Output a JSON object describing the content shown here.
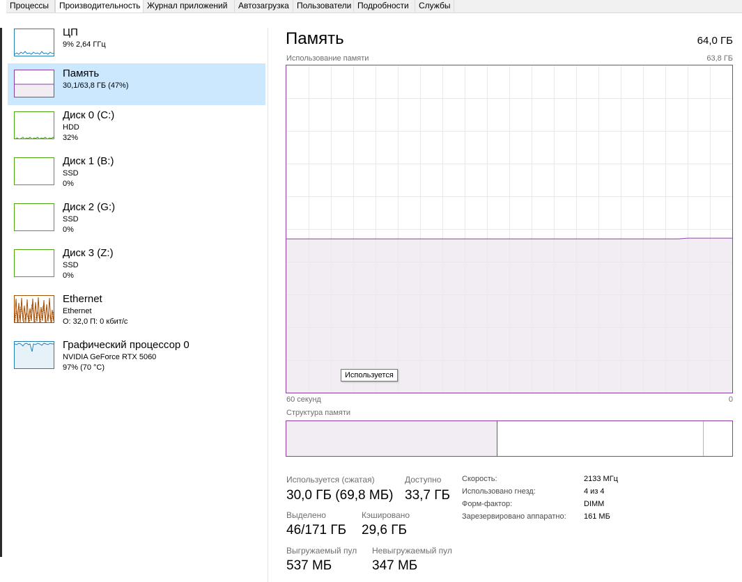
{
  "tabs": [
    "Процессы",
    "Производительность",
    "Журнал приложений",
    "Автозагрузка",
    "Пользователи",
    "Подробности",
    "Службы"
  ],
  "sidebar": {
    "items": [
      {
        "name": "ЦП",
        "sub1": "9%  2,64 ГГц",
        "sub2": "",
        "sub3": "",
        "color": "#1d7fb6"
      },
      {
        "name": "Память",
        "sub1": "30,1/63,8 ГБ (47%)",
        "sub2": "",
        "sub3": "",
        "color": "#8b3ea0"
      },
      {
        "name": "Диск 0 (C:)",
        "sub1": "HDD",
        "sub2": "32%",
        "sub3": "",
        "color": "#4da60c"
      },
      {
        "name": "Диск 1 (B:)",
        "sub1": "SSD",
        "sub2": "0%",
        "sub3": "",
        "color": "#4da60c"
      },
      {
        "name": "Диск 2 (G:)",
        "sub1": "SSD",
        "sub2": "0%",
        "sub3": "",
        "color": "#4da60c"
      },
      {
        "name": "Диск 3 (Z:)",
        "sub1": "SSD",
        "sub2": "0%",
        "sub3": "",
        "color": "#4da60c"
      },
      {
        "name": "Ethernet",
        "sub1": "Ethernet",
        "sub2": "О: 32,0  П: 0 кбит/с",
        "sub3": "",
        "color": "#a74f01"
      },
      {
        "name": "Графический процессор 0",
        "sub1": "NVIDIA GeForce RTX 5060",
        "sub2": "97%  (70 °C)",
        "sub3": "",
        "color": "#1d7fb6"
      }
    ]
  },
  "main": {
    "title": "Память",
    "total": "64,0 ГБ",
    "usage_label": "Использование памяти",
    "usage_max": "63,8 ГБ",
    "time_left": "60 секунд",
    "time_right": "0",
    "tooltip": "Используется",
    "structure_label": "Структура памяти",
    "used_fraction": 0.47
  },
  "stats": {
    "in_use_label": "Используется (сжатая)",
    "in_use_value": "30,0 ГБ (69,8 МБ)",
    "available_label": "Доступно",
    "available_value": "33,7 ГБ",
    "committed_label": "Выделено",
    "committed_value": "46/171 ГБ",
    "cached_label": "Кэшировано",
    "cached_value": "29,6 ГБ",
    "paged_label": "Выгружаемый пул",
    "paged_value": "537 МБ",
    "nonpaged_label": "Невыгружаемый пул",
    "nonpaged_value": "347 МБ"
  },
  "details": [
    {
      "key": "Скорость:",
      "value": "2133 МГц"
    },
    {
      "key": "Использовано гнезд:",
      "value": "4 из 4"
    },
    {
      "key": "Форм-фактор:",
      "value": "DIMM"
    },
    {
      "key": "Зарезервировано аппаратно:",
      "value": "161 МБ"
    }
  ]
}
